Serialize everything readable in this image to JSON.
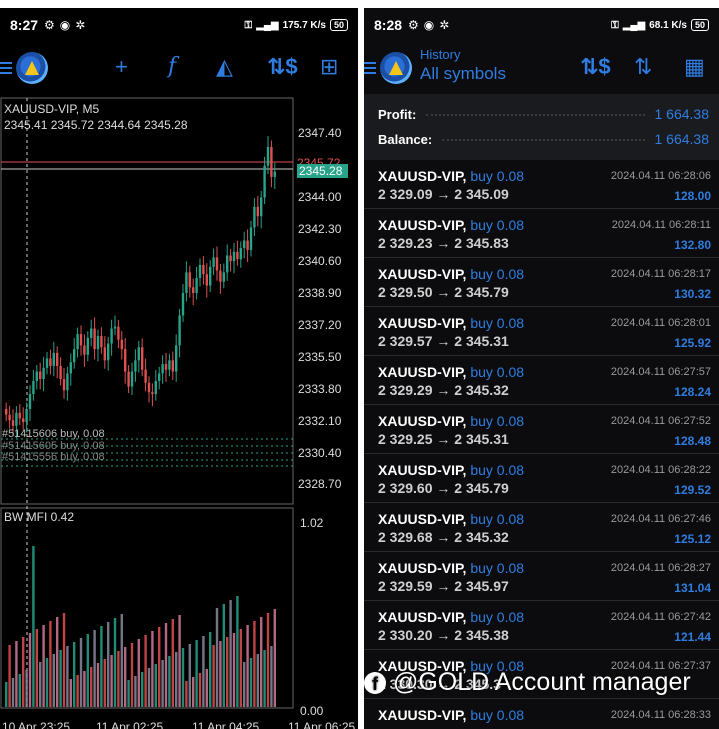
{
  "left": {
    "status": {
      "time": "8:27",
      "speed": "175.7 K/s",
      "battery": "50"
    },
    "toolbar_icons": [
      "crosshair-icon",
      "function-icon",
      "shapes-icon",
      "dollar-swap-icon",
      "add-document-icon"
    ],
    "chart_title": "XAUUSD-VIP, M5",
    "ohlc": "2345.41 2345.72 2344.64 2345.28",
    "current_price": "2345.28",
    "red_price": "2345.72",
    "price_axis": [
      "2347.40",
      "2345.28",
      "2344.00",
      "2342.30",
      "2340.60",
      "2338.90",
      "2337.20",
      "2335.50",
      "2333.80",
      "2332.10",
      "2330.40",
      "2328.70"
    ],
    "order_labels": [
      "#51415606 buy, 0.08",
      "#51415605 buy, 0.08",
      "#51415556 buy, 0.08"
    ],
    "indicator_label": "BW MFI 0.42",
    "indicator_axis": [
      "1.02",
      "0.00"
    ],
    "time_axis": [
      "10 Apr 23:25",
      "11 Apr 02:25",
      "11 Apr 04:25",
      "11 Apr 06:25"
    ]
  },
  "right": {
    "status": {
      "time": "8:28",
      "speed": "68.1 K/s",
      "battery": "50"
    },
    "header_sub": "History",
    "header_main": "All symbols",
    "toolbar_icons": [
      "dollar-swap-icon",
      "sort-icon",
      "calendar-icon"
    ],
    "profit_label": "Profit:",
    "profit_value": "1 664.38",
    "balance_label": "Balance:",
    "balance_value": "1 664.38",
    "deals": [
      {
        "symbol": "XAUUSD-VIP,",
        "side": "buy 0.08",
        "prices": "2 329.09 → 2 345.09",
        "time": "2024.04.11 06:28:06",
        "profit": "128.00"
      },
      {
        "symbol": "XAUUSD-VIP,",
        "side": "buy 0.08",
        "prices": "2 329.23 → 2 345.83",
        "time": "2024.04.11 06:28:11",
        "profit": "132.80"
      },
      {
        "symbol": "XAUUSD-VIP,",
        "side": "buy 0.08",
        "prices": "2 329.50 → 2 345.79",
        "time": "2024.04.11 06:28:17",
        "profit": "130.32"
      },
      {
        "symbol": "XAUUSD-VIP,",
        "side": "buy 0.08",
        "prices": "2 329.57 → 2 345.31",
        "time": "2024.04.11 06:28:01",
        "profit": "125.92"
      },
      {
        "symbol": "XAUUSD-VIP,",
        "side": "buy 0.08",
        "prices": "2 329.29 → 2 345.32",
        "time": "2024.04.11 06:27:57",
        "profit": "128.24"
      },
      {
        "symbol": "XAUUSD-VIP,",
        "side": "buy 0.08",
        "prices": "2 329.25 → 2 345.31",
        "time": "2024.04.11 06:27:52",
        "profit": "128.48"
      },
      {
        "symbol": "XAUUSD-VIP,",
        "side": "buy 0.08",
        "prices": "2 329.60 → 2 345.79",
        "time": "2024.04.11 06:28:22",
        "profit": "129.52"
      },
      {
        "symbol": "XAUUSD-VIP,",
        "side": "buy 0.08",
        "prices": "2 329.68 → 2 345.32",
        "time": "2024.04.11 06:27:46",
        "profit": "125.12"
      },
      {
        "symbol": "XAUUSD-VIP,",
        "side": "buy 0.08",
        "prices": "2 329.59 → 2 345.97",
        "time": "2024.04.11 06:28:27",
        "profit": "131.04"
      },
      {
        "symbol": "XAUUSD-VIP,",
        "side": "buy 0.08",
        "prices": "2 330.20 → 2 345.38",
        "time": "2024.04.11 06:27:42",
        "profit": "121.44"
      },
      {
        "symbol": "XAUUSD-VIP,",
        "side": "buy 0.08",
        "prices": "2 330.30 → 2 345.3",
        "time": "2024.04.11 06:27:37",
        "profit": ""
      },
      {
        "symbol": "XAUUSD-VIP,",
        "side": "buy 0.08",
        "prices": "",
        "time": "2024.04.11 06:28:33",
        "profit": ""
      }
    ]
  },
  "watermark": "@GOLD Account manager",
  "colors": {
    "accent": "#2f7de0",
    "bull": "#27a48a",
    "bear": "#e05050",
    "background": "#000000"
  }
}
